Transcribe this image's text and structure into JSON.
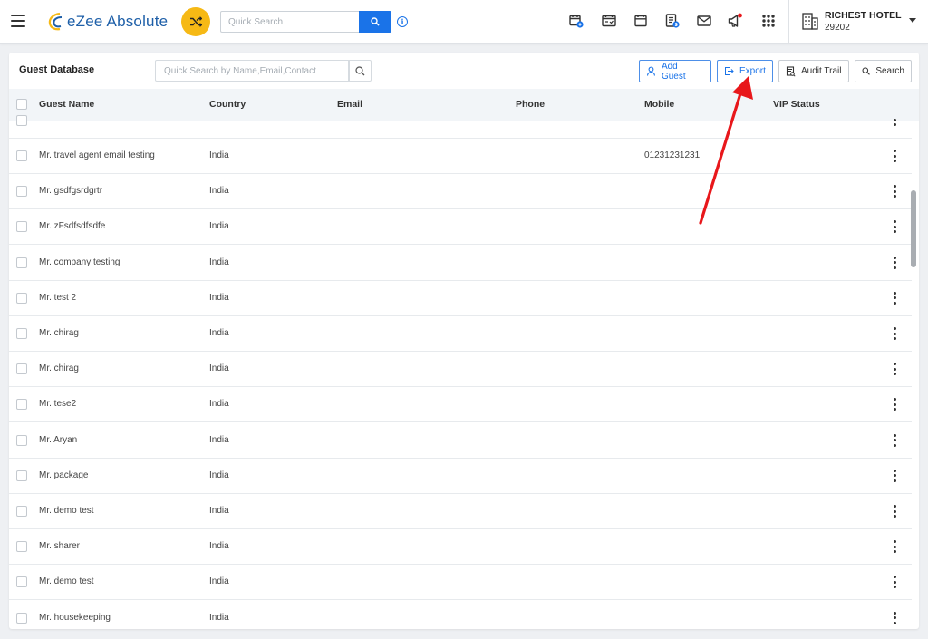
{
  "app": {
    "name": "eZee Absolute",
    "quick_search_placeholder": "Quick Search"
  },
  "hotel": {
    "name": "RICHEST HOTEL",
    "code": "29202"
  },
  "page": {
    "title": "Guest Database",
    "search_placeholder": "Quick Search by Name,Email,Contact",
    "buttons": {
      "add_guest": "Add Guest",
      "export": "Export",
      "audit_trail": "Audit Trail",
      "search": "Search"
    }
  },
  "table": {
    "columns": [
      "Guest Name",
      "Country",
      "Email",
      "Phone",
      "Mobile",
      "VIP Status"
    ],
    "rows": [
      {
        "name": "Mr. travel agent email testing",
        "country": "India",
        "email": "",
        "phone": "",
        "mobile": "01231231231",
        "vip": ""
      },
      {
        "name": "Mr. gsdfgsrdgrtr",
        "country": "India",
        "email": "",
        "phone": "",
        "mobile": "",
        "vip": ""
      },
      {
        "name": "Mr. zFsdfsdfsdfe",
        "country": "India",
        "email": "",
        "phone": "",
        "mobile": "",
        "vip": ""
      },
      {
        "name": "Mr. company testing",
        "country": "India",
        "email": "",
        "phone": "",
        "mobile": "",
        "vip": ""
      },
      {
        "name": "Mr. test 2",
        "country": "India",
        "email": "",
        "phone": "",
        "mobile": "",
        "vip": ""
      },
      {
        "name": "Mr. chirag",
        "country": "India",
        "email": "",
        "phone": "",
        "mobile": "",
        "vip": ""
      },
      {
        "name": "Mr. chirag",
        "country": "India",
        "email": "",
        "phone": "",
        "mobile": "",
        "vip": ""
      },
      {
        "name": "Mr. tese2",
        "country": "India",
        "email": "",
        "phone": "",
        "mobile": "",
        "vip": ""
      },
      {
        "name": "Mr. Aryan",
        "country": "India",
        "email": "",
        "phone": "",
        "mobile": "",
        "vip": ""
      },
      {
        "name": "Mr. package",
        "country": "India",
        "email": "",
        "phone": "",
        "mobile": "",
        "vip": ""
      },
      {
        "name": "Mr. demo test",
        "country": "India",
        "email": "",
        "phone": "",
        "mobile": "",
        "vip": ""
      },
      {
        "name": "Mr. sharer",
        "country": "India",
        "email": "",
        "phone": "",
        "mobile": "",
        "vip": ""
      },
      {
        "name": "Mr. demo test",
        "country": "India",
        "email": "",
        "phone": "",
        "mobile": "",
        "vip": ""
      },
      {
        "name": "Mr. housekeeping",
        "country": "India",
        "email": "",
        "phone": "",
        "mobile": "",
        "vip": ""
      }
    ]
  },
  "toolbar_icons": [
    "calendar-plus-icon",
    "calendar-check-icon",
    "calendar-icon",
    "invoice-dollar-icon",
    "mail-icon",
    "megaphone-icon",
    "apps-grid-icon"
  ],
  "colors": {
    "brand_blue": "#1a73e8",
    "shuffle_yellow": "#f6b915",
    "annotation_red": "#e8171b"
  }
}
